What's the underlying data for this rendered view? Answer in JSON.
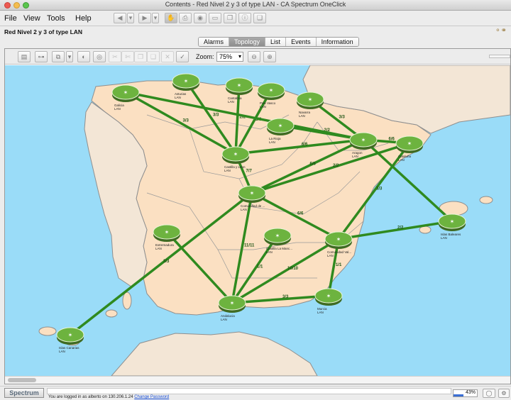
{
  "window": {
    "title": "Contents - Red Nivel 2 y 3 of type LAN - CA Spectrum OneClick"
  },
  "menu": {
    "file": "File",
    "view": "View",
    "tools": "Tools",
    "help": "Help"
  },
  "view_title": "Red Nivel 2 y 3 of type LAN",
  "tabs": [
    {
      "label": "Alarms",
      "selected": false
    },
    {
      "label": "Topology",
      "selected": true
    },
    {
      "label": "List",
      "selected": false
    },
    {
      "label": "Events",
      "selected": false
    },
    {
      "label": "Information",
      "selected": false
    }
  ],
  "zoom": {
    "label": "Zoom:",
    "value": "75%"
  },
  "colors": {
    "land": "#fbe0c2",
    "sea": "#9adcf8",
    "link": "#2f8a1f",
    "node": "#6db33f"
  },
  "nodes": [
    {
      "id": "galicia",
      "name": "Galicia",
      "type": "LAN"
    },
    {
      "id": "asturias",
      "name": "Asturias",
      "type": "LAN"
    },
    {
      "id": "cantabria",
      "name": "Cantabria",
      "type": "LAN"
    },
    {
      "id": "pais-vasco",
      "name": "Pais Vasco",
      "type": "LAN"
    },
    {
      "id": "navarra",
      "name": "Navarra",
      "type": "LAN"
    },
    {
      "id": "la-rioja",
      "name": "La Rioja",
      "type": "LAN"
    },
    {
      "id": "aragon",
      "name": "Aragon",
      "type": "LAN"
    },
    {
      "id": "cataluna",
      "name": "Cataluña",
      "type": "LAN"
    },
    {
      "id": "castilla-leon",
      "name": "Castilla y Leon",
      "type": "LAN"
    },
    {
      "id": "madrid",
      "name": "Comunidad de ...",
      "type": "LAN"
    },
    {
      "id": "extremadura",
      "name": "Extremadura",
      "type": "LAN"
    },
    {
      "id": "castilla-mancha",
      "name": "Castilla La Manc...",
      "type": "LAN"
    },
    {
      "id": "valencia",
      "name": "Comunidad Val...",
      "type": "LAN"
    },
    {
      "id": "baleares",
      "name": "Islas Baleares",
      "type": "LAN"
    },
    {
      "id": "murcia",
      "name": "Murcia",
      "type": "LAN"
    },
    {
      "id": "andalucia",
      "name": "Andalucia",
      "type": "LAN"
    },
    {
      "id": "canarias",
      "name": "Islas Canarias",
      "type": "LAN"
    }
  ],
  "links": [
    {
      "from": "galicia",
      "to": "castilla-leon",
      "label": "3/3"
    },
    {
      "from": "asturias",
      "to": "castilla-leon",
      "label": "3/3"
    },
    {
      "from": "cantabria",
      "to": "castilla-leon",
      "label": "2/2"
    },
    {
      "from": "pais-vasco",
      "to": "castilla-leon",
      "label": "3/3"
    },
    {
      "from": "navarra",
      "to": "aragon",
      "label": "3/3"
    },
    {
      "from": "la-rioja",
      "to": "aragon",
      "label": "2/2"
    },
    {
      "from": "castilla-leon",
      "to": "aragon",
      "label": "6/6"
    },
    {
      "from": "aragon",
      "to": "cataluna",
      "label": "6/6"
    },
    {
      "from": "galicia",
      "to": "aragon",
      "label": ""
    },
    {
      "from": "castilla-leon",
      "to": "madrid",
      "label": "7/7"
    },
    {
      "from": "madrid",
      "to": "aragon",
      "label": "6/6"
    },
    {
      "from": "madrid",
      "to": "cataluna",
      "label": "2/2"
    },
    {
      "from": "aragon",
      "to": "baleares",
      "label": ""
    },
    {
      "from": "madrid",
      "to": "valencia",
      "label": "6/6"
    },
    {
      "from": "madrid",
      "to": "andalucia",
      "label": "11/11"
    },
    {
      "from": "madrid",
      "to": "canarias",
      "label": "3/3"
    },
    {
      "from": "extremadura",
      "to": "andalucia",
      "label": ""
    },
    {
      "from": "valencia",
      "to": "baleares",
      "label": "2/2"
    },
    {
      "from": "cataluna",
      "to": "valencia",
      "label": "3/3"
    },
    {
      "from": "valencia",
      "to": "murcia",
      "label": "1/1"
    },
    {
      "from": "valencia",
      "to": "andalucia",
      "label": "10/10"
    },
    {
      "from": "andalucia",
      "to": "murcia",
      "label": "3/3"
    },
    {
      "from": "castilla-mancha",
      "to": "andalucia",
      "label": "1/1"
    }
  ],
  "status": {
    "logo": "Spectrum",
    "login_text": "You are logged in as alberto on 130.206.1.24",
    "change_password": "Change Password",
    "progress_label": "43%",
    "progress_fraction": 0.43
  }
}
